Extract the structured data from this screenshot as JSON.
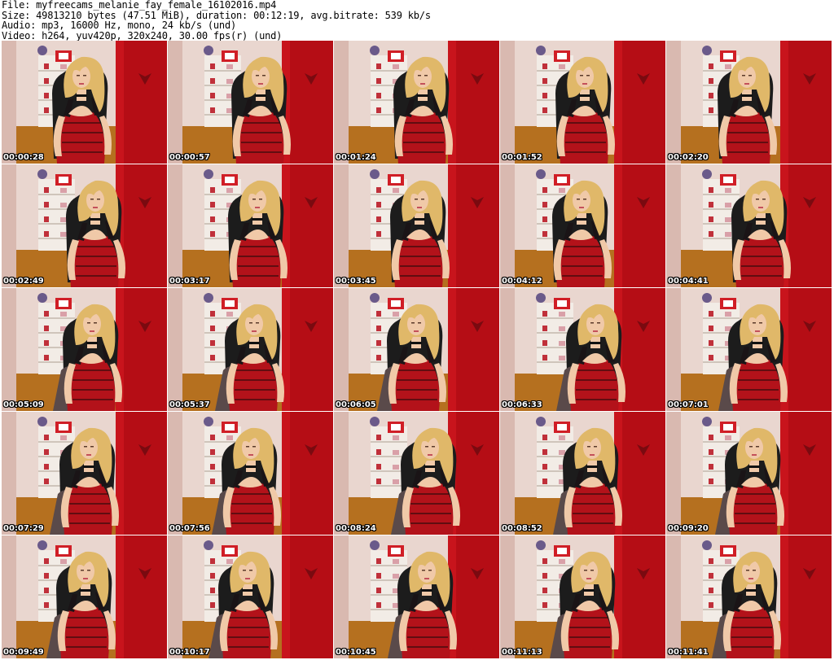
{
  "header": {
    "file_line": "File: myfreecams_melanie_fay_female_16102016.mp4",
    "size_line": "Size: 49813210 bytes (47.51 MiB), duration: 00:12:19, avg.bitrate: 539 kb/s",
    "audio_line": "Audio: mp3, 16000 Hz, mono, 24 kb/s (und)",
    "video_line": "Video: h264, yuv420p, 320x240, 30.00 fps(r) (und)"
  },
  "thumbnails": [
    {
      "time": "00:00:28"
    },
    {
      "time": "00:00:57"
    },
    {
      "time": "00:01:24"
    },
    {
      "time": "00:01:52"
    },
    {
      "time": "00:02:20"
    },
    {
      "time": "00:02:49"
    },
    {
      "time": "00:03:17"
    },
    {
      "time": "00:03:45"
    },
    {
      "time": "00:04:12"
    },
    {
      "time": "00:04:41"
    },
    {
      "time": "00:05:09"
    },
    {
      "time": "00:05:37"
    },
    {
      "time": "00:06:05"
    },
    {
      "time": "00:06:33"
    },
    {
      "time": "00:07:01"
    },
    {
      "time": "00:07:29"
    },
    {
      "time": "00:07:56"
    },
    {
      "time": "00:08:24"
    },
    {
      "time": "00:08:52"
    },
    {
      "time": "00:09:20"
    },
    {
      "time": "00:09:49"
    },
    {
      "time": "00:10:17"
    },
    {
      "time": "00:10:45"
    },
    {
      "time": "00:11:13"
    },
    {
      "time": "00:11:41"
    }
  ],
  "colors": {
    "wall_red": "#c8141c",
    "wall_left": "#e9d6cf",
    "floor": "#b5701f",
    "shelf": "#f2ece6",
    "chair": "#1c1c1c",
    "hair": "#e0b869",
    "skin": "#f0c9a8",
    "dress_red": "#b3121a",
    "dress_black": "#1a1416",
    "stocking": "#5a4a4a"
  }
}
